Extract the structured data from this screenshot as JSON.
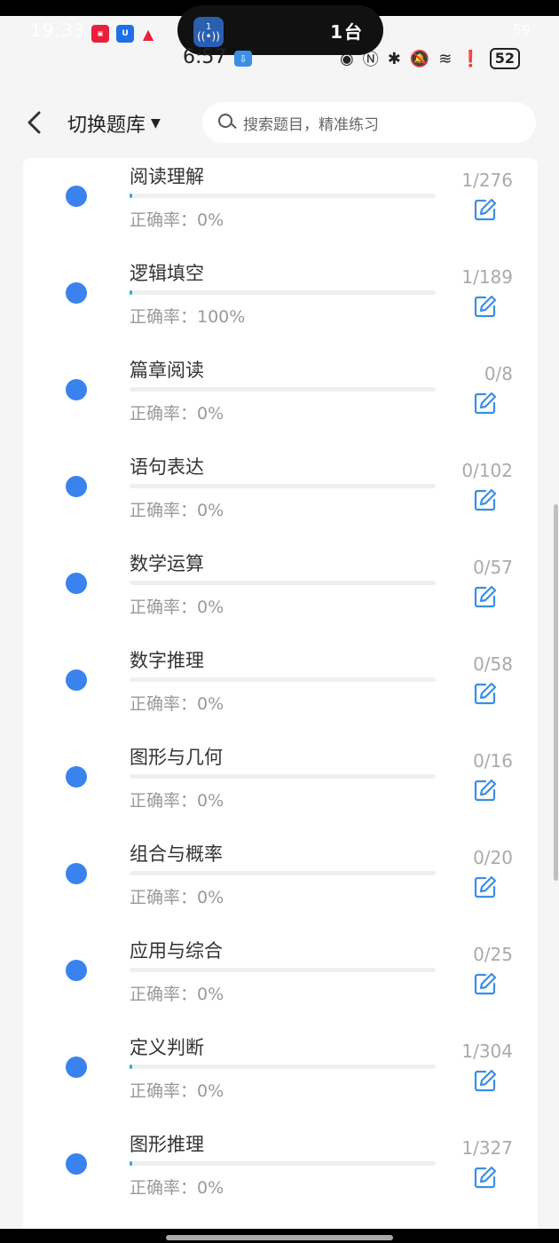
{
  "status_bar": {
    "ghost_time": "19:33",
    "ghost_right": "59",
    "pill_icon_number": "1",
    "pill_text": "1台",
    "time": "6:57",
    "battery": "52"
  },
  "header": {
    "back_icon": "chevron-left-icon",
    "switch_label": "切换题库",
    "search_placeholder": "搜索题目，精准练习"
  },
  "colors": {
    "dot": "#3a82ee",
    "progress": "#2bb1c2",
    "edit": "#3a8ee6"
  },
  "items": [
    {
      "title": "阅读理解",
      "accuracy": "正确率：0%",
      "count": "1/276",
      "progress": 0.0036
    },
    {
      "title": "逻辑填空",
      "accuracy": "正确率：100%",
      "count": "1/189",
      "progress": 0.0053
    },
    {
      "title": "篇章阅读",
      "accuracy": "正确率：0%",
      "count": "0/8",
      "progress": 0
    },
    {
      "title": "语句表达",
      "accuracy": "正确率：0%",
      "count": "0/102",
      "progress": 0
    },
    {
      "title": "数学运算",
      "accuracy": "正确率：0%",
      "count": "0/57",
      "progress": 0
    },
    {
      "title": "数字推理",
      "accuracy": "正确率：0%",
      "count": "0/58",
      "progress": 0
    },
    {
      "title": "图形与几何",
      "accuracy": "正确率：0%",
      "count": "0/16",
      "progress": 0
    },
    {
      "title": "组合与概率",
      "accuracy": "正确率：0%",
      "count": "0/20",
      "progress": 0
    },
    {
      "title": "应用与综合",
      "accuracy": "正确率：0%",
      "count": "0/25",
      "progress": 0
    },
    {
      "title": "定义判断",
      "accuracy": "正确率：0%",
      "count": "1/304",
      "progress": 0.0033
    },
    {
      "title": "图形推理",
      "accuracy": "正确率：0%",
      "count": "1/327",
      "progress": 0.0031
    }
  ]
}
